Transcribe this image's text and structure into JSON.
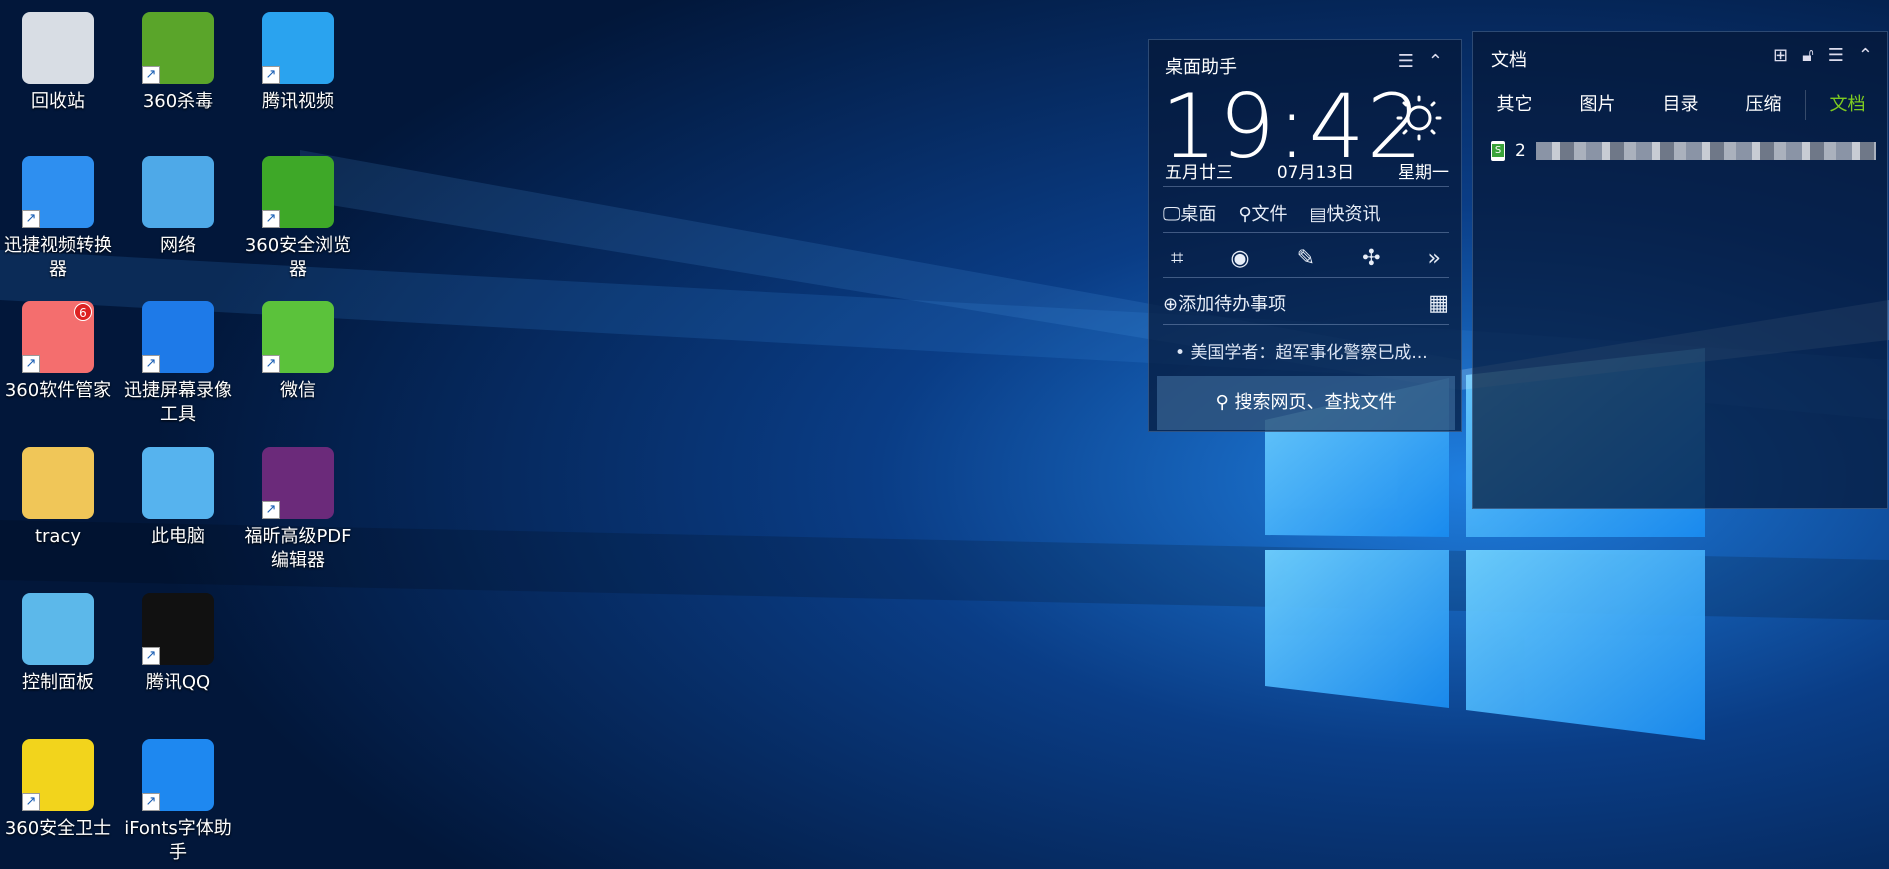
{
  "desktop_icons": [
    {
      "label": "回收站",
      "icon": "recycle-bin-icon",
      "color": "#d8dde4",
      "shortcut": false
    },
    {
      "label": "360杀毒",
      "icon": "shield-bolt-icon",
      "color": "#5aa52a",
      "shortcut": true
    },
    {
      "label": "腾讯视频",
      "icon": "tencent-video-icon",
      "color": "#2aa3ef",
      "shortcut": true
    },
    {
      "label": "迅捷视频转换器",
      "icon": "video-converter-icon",
      "color": "#2e8ff0",
      "shortcut": true
    },
    {
      "label": "网络",
      "icon": "network-icon",
      "color": "#4ea9e8",
      "shortcut": false
    },
    {
      "label": "360安全浏览器",
      "icon": "browser-icon",
      "color": "#3ea828",
      "shortcut": true
    },
    {
      "label": "360软件管家",
      "icon": "software-manager-icon",
      "color": "#f46e6e",
      "shortcut": true,
      "badge": "6"
    },
    {
      "label": "迅捷屏幕录像工具",
      "icon": "screen-recorder-icon",
      "color": "#1e7ae8",
      "shortcut": true
    },
    {
      "label": "微信",
      "icon": "wechat-icon",
      "color": "#5bc23b",
      "shortcut": true
    },
    {
      "label": "tracy",
      "icon": "user-folder-icon",
      "color": "#f0c658",
      "shortcut": false
    },
    {
      "label": "此电脑",
      "icon": "computer-icon",
      "color": "#56b3ee",
      "shortcut": false
    },
    {
      "label": "福昕高级PDF编辑器",
      "icon": "pdf-editor-icon",
      "color": "#6b2a7a",
      "shortcut": true
    },
    {
      "label": "控制面板",
      "icon": "control-panel-icon",
      "color": "#5cb8ea",
      "shortcut": false
    },
    {
      "label": "腾讯QQ",
      "icon": "qq-penguin-icon",
      "color": "#111111",
      "shortcut": true
    },
    null,
    {
      "label": "360安全卫士",
      "icon": "security-guard-icon",
      "color": "#f2d41c",
      "shortcut": true
    },
    {
      "label": "iFonts字体助手",
      "icon": "ifonts-icon",
      "color": "#1e88f0",
      "shortcut": true
    }
  ],
  "assistant": {
    "title": "桌面助手",
    "time": "19:42",
    "lunar_date": "五月廿三",
    "date": "07月13日",
    "weekday": "星期一",
    "quick_links": [
      "桌面",
      "文件",
      "快资讯"
    ],
    "add_todo": "添加待办事项",
    "news": "美国学者：超军事化警察已成...",
    "search_placeholder": "搜索网页、查找文件"
  },
  "docs": {
    "title": "文档",
    "tabs": [
      "其它",
      "图片",
      "目录",
      "压缩",
      "文档"
    ],
    "active_tab": "文档",
    "active_color": "#7ecb20",
    "file_name_prefix": "2"
  }
}
